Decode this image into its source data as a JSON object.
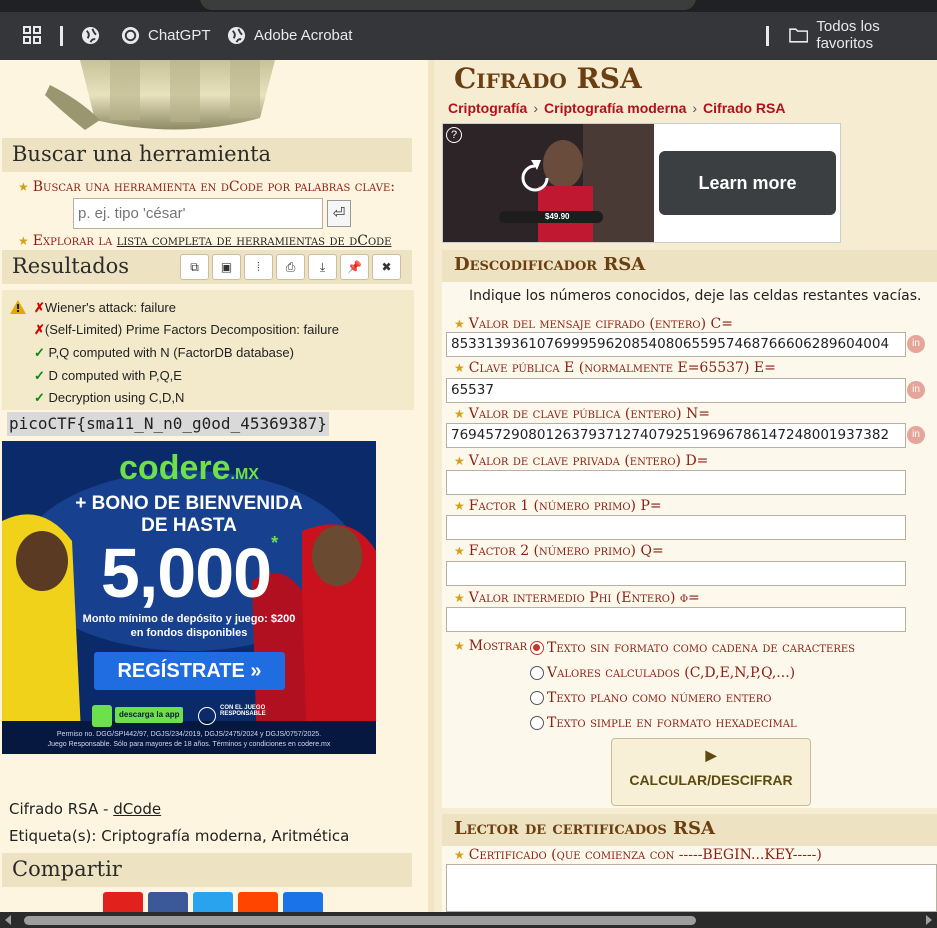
{
  "bookmarks": {
    "items": [
      {
        "label": "ChatGPT",
        "icon": "openai-icon"
      },
      {
        "label": "Adobe Acrobat",
        "icon": "globe-icon"
      }
    ],
    "all_favorites": "Todos los favoritos"
  },
  "left": {
    "search_header": "Buscar una herramienta",
    "search_prompt": "Buscar una herramienta en dCode por palabras clave:",
    "search_placeholder": "p. ej. tipo 'césar'",
    "explore_prefix": "Explorar la ",
    "explore_link": "lista completa de herramientas de dCode",
    "results_header": "Resultados",
    "results": [
      {
        "status": "fail",
        "text": "Wiener's attack: failure"
      },
      {
        "status": "fail",
        "text": "(Self-Limited) Prime Factors Decomposition: failure"
      },
      {
        "status": "ok",
        "text": "P,Q computed with N (FactorDB database)"
      },
      {
        "status": "ok",
        "text": "D computed with P,Q,E"
      },
      {
        "status": "ok",
        "text": "Decryption using C,D,N"
      }
    ],
    "flag": "picoCTF{sma11_N_n0_g0od_45369387}",
    "ad": {
      "brand": "codere",
      "brand_suffix": ".MX",
      "line1": "+ BONO DE BIENVENIDA",
      "line2": "DE HASTA",
      "amount": "5,000",
      "asterisk": "*",
      "line3": "Monto mínimo de depósito y juego: $200",
      "line4": "en fondos disponibles",
      "cta": "REGÍSTRATE »",
      "app": "descarga la app",
      "responsible": "CON EL JUEGO RESPONSABLE",
      "fine1": "Permiso no. DGG/SPI442/97, DGJS/234/2019, DGJS/2475/2024 y DGJS/0757/2025.",
      "fine2": "Juego Responsable. Sólo para mayores de 18 años. Términos y condiciones en codere.mx"
    },
    "page_label": "Cifrado RSA - ",
    "page_label_link": "dCode",
    "tags": "Etiqueta(s): Criptografía moderna, Aritmética",
    "share_header": "Compartir"
  },
  "right": {
    "title": "Cifrado RSA",
    "breadcrumbs": [
      "Criptografía",
      "Criptografía moderna",
      "Cifrado RSA"
    ],
    "video_ad_cta": "Learn more",
    "video_ad_price": "$49.90",
    "decoder_header": "Descodificador RSA",
    "instructions": "Indique los números conocidos, deje las celdas restantes vacías.",
    "fields": [
      {
        "label": "Valor del mensaje cifrado (entero) C=",
        "value": "853313936107699959620854080655957468766606289604004"
      },
      {
        "label": "Clave pública E (normalmente E=65537) E=",
        "value": "65537"
      },
      {
        "label": "Valor de clave pública (entero) N=",
        "value": "769457290801263793712740792519696786147248001937382"
      },
      {
        "label": "Valor de clave privada (entero) D=",
        "value": ""
      },
      {
        "label": "Factor 1 (número primo) P=",
        "value": ""
      },
      {
        "label": "Factor 2 (número primo) Q=",
        "value": ""
      },
      {
        "label": "Valor intermedio Phi (Entero) φ=",
        "value": ""
      }
    ],
    "show_label": "Mostrar",
    "show_options": [
      {
        "label": "Texto sin formato como cadena de caracteres",
        "selected": true
      },
      {
        "label": "Valores calculados (C,D,E,N,P,Q,...)",
        "selected": false
      },
      {
        "label": "Texto plano como número entero",
        "selected": false
      },
      {
        "label": "Texto simple en formato hexadecimal",
        "selected": false
      }
    ],
    "calc_button": "CALCULAR/DESCIFRAR",
    "cert_header": "Lector de certificados RSA",
    "cert_label": "Certificado (que comienza con -----BEGIN...KEY-----)"
  },
  "colors": {
    "accent_red": "#8a1f12",
    "title_brown": "#6b3f12",
    "link_red": "#b0121b",
    "panel_bg": "#ede2c1"
  }
}
